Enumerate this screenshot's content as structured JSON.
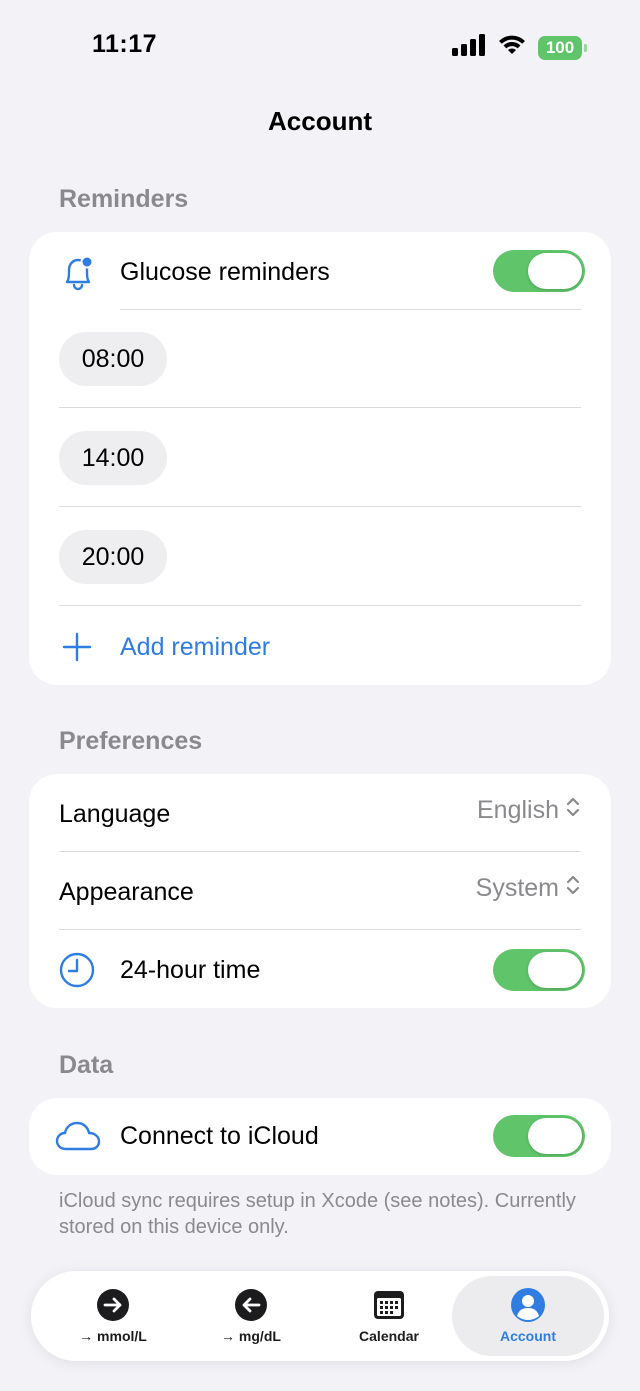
{
  "status_bar": {
    "time": "11:17",
    "battery": "100"
  },
  "nav": {
    "title": "Account"
  },
  "reminders": {
    "header": "Reminders",
    "toggle_label": "Glucose reminders",
    "times": [
      "08:00",
      "14:00",
      "20:00"
    ],
    "add_label": "Add reminder"
  },
  "preferences": {
    "header": "Preferences",
    "language_label": "Language",
    "language_value": "English",
    "appearance_label": "Appearance",
    "appearance_value": "System",
    "time_format_label": "24-hour time"
  },
  "data": {
    "header": "Data",
    "icloud_label": "Connect to iCloud",
    "footnote": "iCloud sync requires setup in Xcode (see notes). Currently stored on this device only."
  },
  "tabbar": {
    "tabs": [
      {
        "label": "→ mmol/L",
        "icon": "arrow-right-circle-icon"
      },
      {
        "label": "→ mg/dL",
        "icon": "arrow-left-circle-icon"
      },
      {
        "label": "Calendar",
        "icon": "calendar-icon"
      },
      {
        "label": "Account",
        "icon": "person-circle-icon",
        "active": true
      }
    ]
  },
  "colors": {
    "accent": "#2f7de1",
    "toggle_on": "#5fc46a",
    "background": "#f2f2f7"
  }
}
